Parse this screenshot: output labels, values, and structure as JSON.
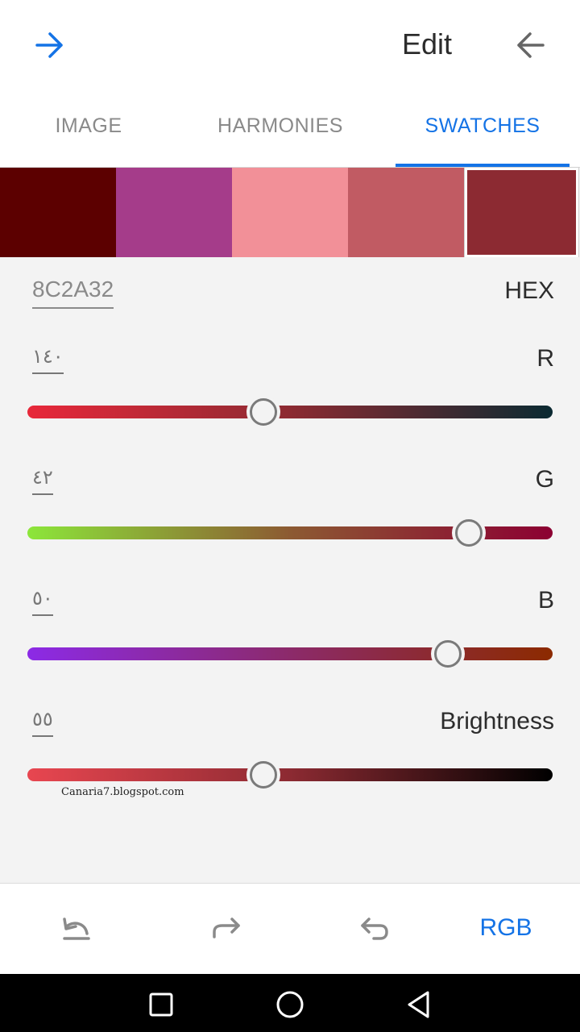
{
  "header": {
    "title": "Edit",
    "forward_icon": "arrow-right-icon",
    "back_icon": "arrow-left-icon",
    "accent": "#1473e6"
  },
  "tabs": [
    {
      "label": "IMAGE",
      "active": false
    },
    {
      "label": "HARMONIES",
      "active": false
    },
    {
      "label": "SWATCHES",
      "active": true
    }
  ],
  "swatches": [
    {
      "color": "#5c0000",
      "selected": false
    },
    {
      "color": "#a53c8a",
      "selected": false
    },
    {
      "color": "#f29098",
      "selected": false
    },
    {
      "color": "#c15b63",
      "selected": false
    },
    {
      "color": "#8c2a32",
      "selected": true
    }
  ],
  "editor": {
    "hex": {
      "value": "8C2A32",
      "label": "HEX"
    },
    "sliders": [
      {
        "key": "r",
        "label": "R",
        "value": "١٤٠",
        "fraction": 0.45,
        "gradient": [
          "#e8283a",
          "#8c2a32",
          "#0b2a32"
        ]
      },
      {
        "key": "g",
        "label": "G",
        "value": "٤٢",
        "fraction": 0.84,
        "gradient": [
          "#8ce63a",
          "#8c5a32",
          "#8c0032"
        ]
      },
      {
        "key": "b",
        "label": "B",
        "value": "٥٠",
        "fraction": 0.8,
        "gradient": [
          "#8c2ae6",
          "#8c2a6a",
          "#8c2a00"
        ]
      },
      {
        "key": "brightness",
        "label": "Brightness",
        "value": "٥٥",
        "fraction": 0.45,
        "gradient": [
          "#e84650",
          "#8c2a32",
          "#000000"
        ]
      }
    ]
  },
  "watermark": "Canaria7.blogspot.com",
  "toolbar": {
    "undo_icon": "undo-icon",
    "redo_icon": "redo-icon",
    "revert_icon": "revert-icon",
    "mode_label": "RGB"
  },
  "navbar": {
    "recents_icon": "square-icon",
    "home_icon": "circle-icon",
    "back_icon": "triangle-back-icon"
  }
}
